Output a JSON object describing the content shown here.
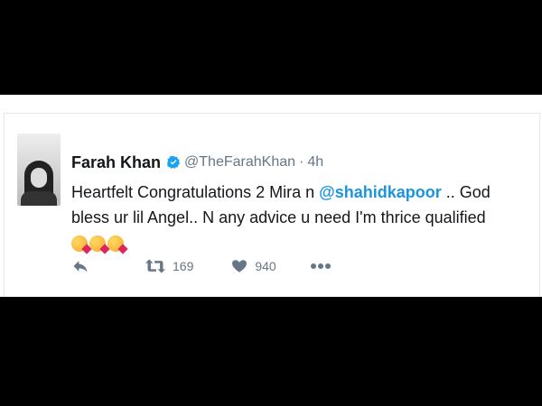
{
  "tweet": {
    "name": "Farah Khan",
    "handle": "@TheFarahKhan",
    "separator": "·",
    "time": "4h",
    "text_before": "Heartfelt Congratulations 2 Mira n ",
    "mention": "@shahidkapoor",
    "text_after": " .. God bless ur lil Angel.. N any advice u need I'm thrice qualified",
    "retweets": "169",
    "likes": "940"
  },
  "icons": {
    "avatar": "profile-photo",
    "verified": "verified-badge-icon",
    "reply": "reply-icon",
    "retweet": "retweet-icon",
    "like": "heart-icon",
    "more": "more-icon",
    "emoji": "kissing-face-emoji"
  },
  "colors": {
    "background": "#000000",
    "card": "#ffffff",
    "mention": "#1b95e0",
    "meta": "#657786",
    "verified": "#1da1f2"
  }
}
